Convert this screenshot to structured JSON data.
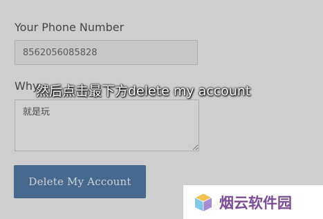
{
  "form": {
    "phone_label": "Your Phone Number",
    "phone_value": "8562056085828",
    "why_label": "Why",
    "reason_value": "就是玩",
    "delete_button_label": "Delete My Account"
  },
  "overlay": {
    "subtitle": "然后点击最下方delete my account"
  },
  "watermark": {
    "text": "烟云软件园",
    "logo_icon": "cube-logo-icon"
  },
  "colors": {
    "background": "#e9e9e9",
    "button": "#3b6a99",
    "watermark_text": "#7c4a96"
  }
}
